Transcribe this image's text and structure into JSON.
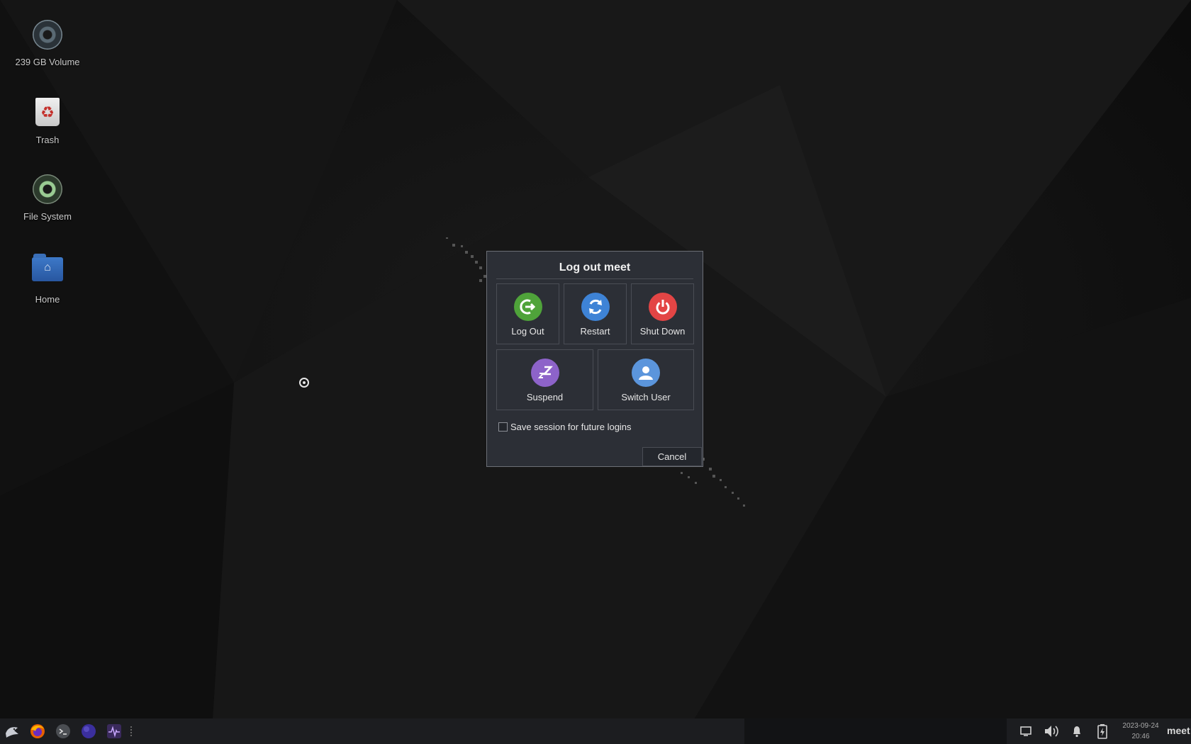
{
  "desktop_icons": [
    {
      "label": "239 GB Volume",
      "icon": "drive-icon"
    },
    {
      "label": "Trash",
      "icon": "trash-icon"
    },
    {
      "label": "File System",
      "icon": "filesystem-icon"
    },
    {
      "label": "Home",
      "icon": "home-folder-icon"
    }
  ],
  "dialog": {
    "title": "Log out meet",
    "actions": [
      {
        "label": "Log Out",
        "icon": "logout-icon",
        "color": "#4fa33a"
      },
      {
        "label": "Restart",
        "icon": "restart-icon",
        "color": "#3e83d6"
      },
      {
        "label": "Shut Down",
        "icon": "power-icon",
        "color": "#e34545"
      },
      {
        "label": "Suspend",
        "icon": "suspend-icon",
        "color": "#8d63c9"
      },
      {
        "label": "Switch User",
        "icon": "user-icon",
        "color": "#5b95dc"
      }
    ],
    "save_session_label": "Save session for future logins",
    "save_session_checked": false,
    "cancel_label": "Cancel"
  },
  "taskbar": {
    "launchers": [
      "menu-icon",
      "firefox-icon",
      "terminal-icon",
      "browser-icon",
      "task-manager-icon"
    ],
    "tray": [
      "display-icon",
      "volume-icon",
      "notification-bell-icon",
      "power-manager-icon"
    ],
    "clock_date": "2023-09-24",
    "clock_time": "20:46",
    "user": "meet"
  }
}
